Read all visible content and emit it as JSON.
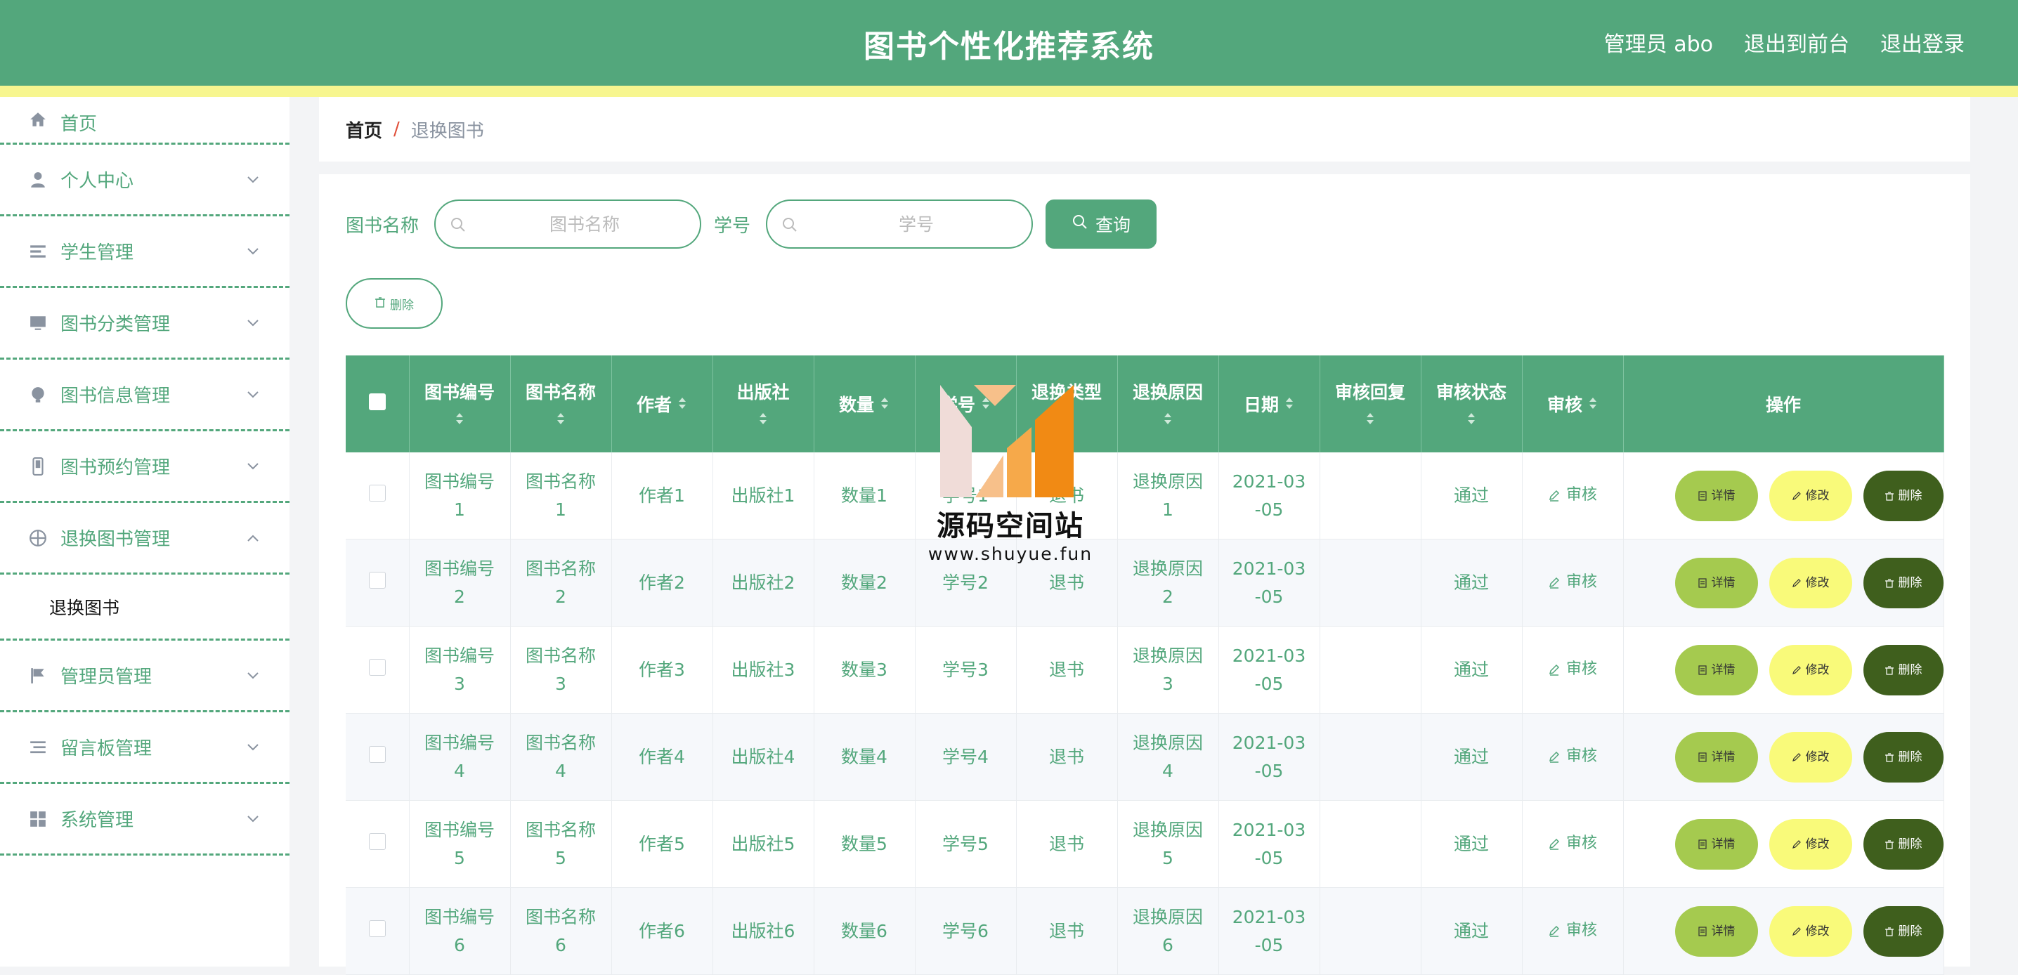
{
  "header": {
    "title": "图书个性化推荐系统",
    "admin_label": "管理员 abo",
    "exit_front": "退出到前台",
    "logout": "退出登录"
  },
  "sidebar": {
    "items": [
      {
        "label": "首页",
        "icon": "home-icon"
      },
      {
        "label": "个人中心",
        "icon": "user-icon"
      },
      {
        "label": "学生管理",
        "icon": "list-icon"
      },
      {
        "label": "图书分类管理",
        "icon": "monitor-icon"
      },
      {
        "label": "图书信息管理",
        "icon": "bulb-icon"
      },
      {
        "label": "图书预约管理",
        "icon": "phone-icon"
      },
      {
        "label": "退换图书管理",
        "icon": "globe-icon",
        "expanded": true
      },
      {
        "label": "管理员管理",
        "icon": "flag-icon"
      },
      {
        "label": "留言板管理",
        "icon": "lines-icon"
      },
      {
        "label": "系统管理",
        "icon": "grid-icon"
      }
    ],
    "sub_item": "退换图书"
  },
  "breadcrumb": {
    "home": "首页",
    "separator": "/",
    "current": "退换图书"
  },
  "search": {
    "name_label": "图书名称",
    "name_placeholder": "图书名称",
    "student_label": "学号",
    "student_placeholder": "学号",
    "query_button": "查询",
    "delete_button": "删除"
  },
  "table": {
    "headers": [
      "图书编号",
      "图书名称",
      "作者",
      "出版社",
      "数量",
      "学号",
      "退换类型",
      "退换原因",
      "日期",
      "审核回复",
      "审核状态",
      "审核",
      "操作"
    ],
    "rows": [
      {
        "book_no": "图书编号1",
        "book_name": "图书名称1",
        "author": "作者1",
        "publisher": "出版社1",
        "qty": "数量1",
        "student_no": "学号1",
        "type": "退书",
        "reason": "退换原因1",
        "date": "2021-03-05",
        "reply": "",
        "status": "通过"
      },
      {
        "book_no": "图书编号2",
        "book_name": "图书名称2",
        "author": "作者2",
        "publisher": "出版社2",
        "qty": "数量2",
        "student_no": "学号2",
        "type": "退书",
        "reason": "退换原因2",
        "date": "2021-03-05",
        "reply": "",
        "status": "通过"
      },
      {
        "book_no": "图书编号3",
        "book_name": "图书名称3",
        "author": "作者3",
        "publisher": "出版社3",
        "qty": "数量3",
        "student_no": "学号3",
        "type": "退书",
        "reason": "退换原因3",
        "date": "2021-03-05",
        "reply": "",
        "status": "通过"
      },
      {
        "book_no": "图书编号4",
        "book_name": "图书名称4",
        "author": "作者4",
        "publisher": "出版社4",
        "qty": "数量4",
        "student_no": "学号4",
        "type": "退书",
        "reason": "退换原因4",
        "date": "2021-03-05",
        "reply": "",
        "status": "通过"
      },
      {
        "book_no": "图书编号5",
        "book_name": "图书名称5",
        "author": "作者5",
        "publisher": "出版社5",
        "qty": "数量5",
        "student_no": "学号5",
        "type": "退书",
        "reason": "退换原因5",
        "date": "2021-03-05",
        "reply": "",
        "status": "通过"
      },
      {
        "book_no": "图书编号6",
        "book_name": "图书名称6",
        "author": "作者6",
        "publisher": "出版社6",
        "qty": "数量6",
        "student_no": "学号6",
        "type": "退书",
        "reason": "退换原因6",
        "date": "2021-03-05",
        "reply": "",
        "status": "通过"
      }
    ],
    "audit_link": "审核",
    "detail_button": "详情",
    "edit_button": "修改",
    "delete_button": "删除"
  },
  "watermark": {
    "title": "源码空间站",
    "url": "www.shuyue.fun"
  },
  "colors": {
    "primary": "#53a77c",
    "stripe": "#f7f68f",
    "detail": "#a5ca4f",
    "edit": "#f9fa7a",
    "delete": "#3f5f1d"
  }
}
